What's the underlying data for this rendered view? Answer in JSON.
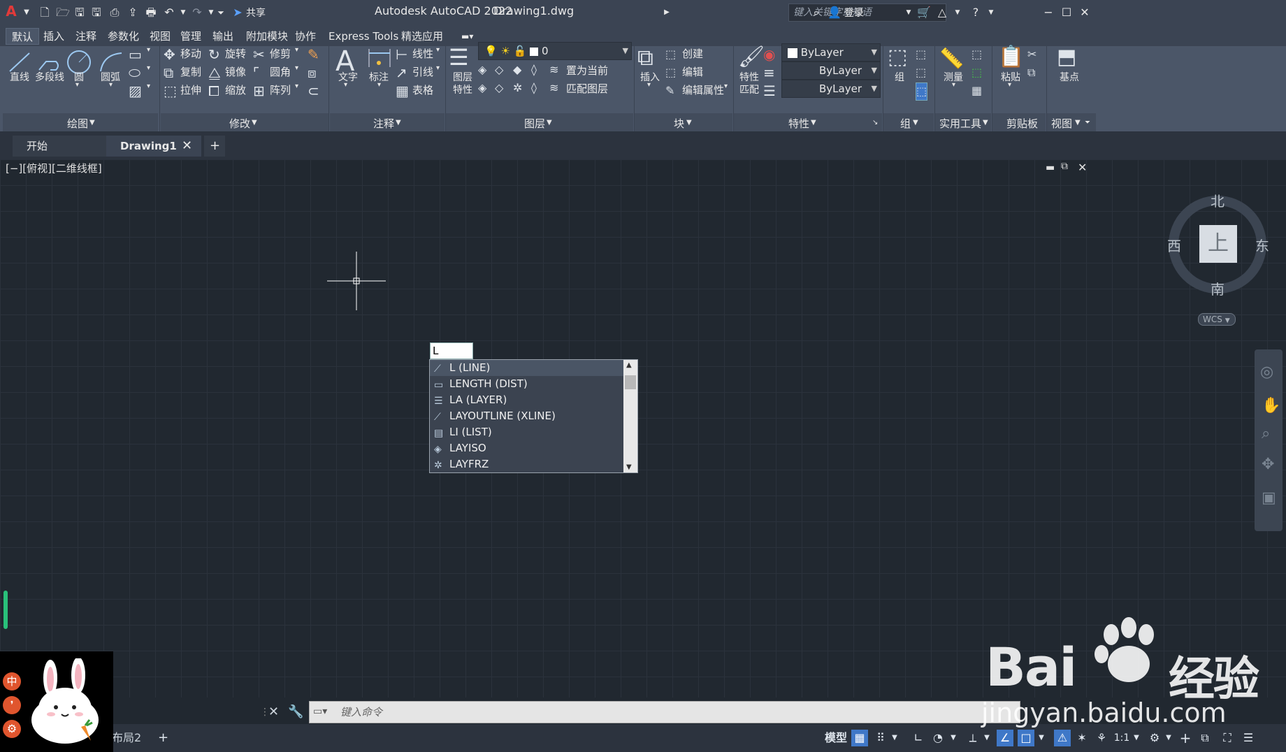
{
  "titlebar": {
    "app_title": "Autodesk AutoCAD 2022",
    "doc_title": "Drawing1.dwg",
    "share_label": "共享",
    "search_placeholder": "键入关键字或短语",
    "login_label": "登录"
  },
  "menu": {
    "tabs": [
      {
        "label": "默认"
      },
      {
        "label": "插入"
      },
      {
        "label": "注释"
      },
      {
        "label": "参数化"
      },
      {
        "label": "视图"
      },
      {
        "label": "管理"
      },
      {
        "label": "输出"
      },
      {
        "label": "附加模块"
      },
      {
        "label": "协作"
      },
      {
        "label": "Express Tools"
      },
      {
        "label": "精选应用"
      }
    ]
  },
  "ribbon": {
    "draw": {
      "title": "绘图",
      "line": "直线",
      "polyline": "多段线",
      "circle": "圆",
      "arc": "圆弧"
    },
    "modify": {
      "title": "修改",
      "move": "移动",
      "rotate": "旋转",
      "trim": "修剪",
      "copy": "复制",
      "mirror": "镜像",
      "fillet": "圆角",
      "stretch": "拉伸",
      "scale": "缩放",
      "array": "阵列"
    },
    "annotation": {
      "title": "注释",
      "text": "文字",
      "dimension": "标注",
      "linear": "线性",
      "leader": "引线",
      "table": "表格"
    },
    "layers": {
      "title": "图层",
      "properties_line1": "图层",
      "properties_line2": "特性",
      "current_layer": "0",
      "make_current": "置为当前",
      "match_layer": "匹配图层"
    },
    "block": {
      "title": "块",
      "insert": "插入",
      "create": "创建",
      "edit": "编辑",
      "edit_attributes": "编辑属性"
    },
    "properties": {
      "title": "特性",
      "match_line1": "特性",
      "match_line2": "匹配",
      "color": "ByLayer",
      "lineweight": "ByLayer",
      "linetype": "ByLayer"
    },
    "groups": {
      "title": "组",
      "group": "组"
    },
    "utilities": {
      "title": "实用工具",
      "measure": "测量"
    },
    "clipboard": {
      "title": "剪贴板",
      "paste": "粘贴"
    },
    "view": {
      "title": "视图",
      "base": "基点"
    }
  },
  "doctabs": {
    "start": "开始",
    "drawing": "Drawing1"
  },
  "viewport": {
    "label": "[−][俯视][二维线框]"
  },
  "command": {
    "typed": "L",
    "autocomplete": [
      {
        "label": "L (LINE)",
        "icon": "line-icon"
      },
      {
        "label": "LENGTH (DIST)",
        "icon": "ruler-icon"
      },
      {
        "label": "LA (LAYER)",
        "icon": "layers-icon"
      },
      {
        "label": "LAYOUTLINE (XLINE)",
        "icon": "xline-icon"
      },
      {
        "label": "LI (LIST)",
        "icon": "list-icon"
      },
      {
        "label": "LAYISO",
        "icon": "layiso-icon"
      },
      {
        "label": "LAYFRZ",
        "icon": "layfrz-icon"
      }
    ],
    "placeholder": "键入命令"
  },
  "viewcube": {
    "north": "北",
    "south": "南",
    "east": "东",
    "west": "西",
    "top": "上",
    "wcs": "WCS"
  },
  "statusbar": {
    "layout2": "布局2",
    "model": "模型",
    "scale": "1:1"
  },
  "ime": {
    "zh": "中"
  },
  "watermark": {
    "brand": "Bai",
    "brand2": "经验",
    "url": "jingyan.baidu.com"
  }
}
